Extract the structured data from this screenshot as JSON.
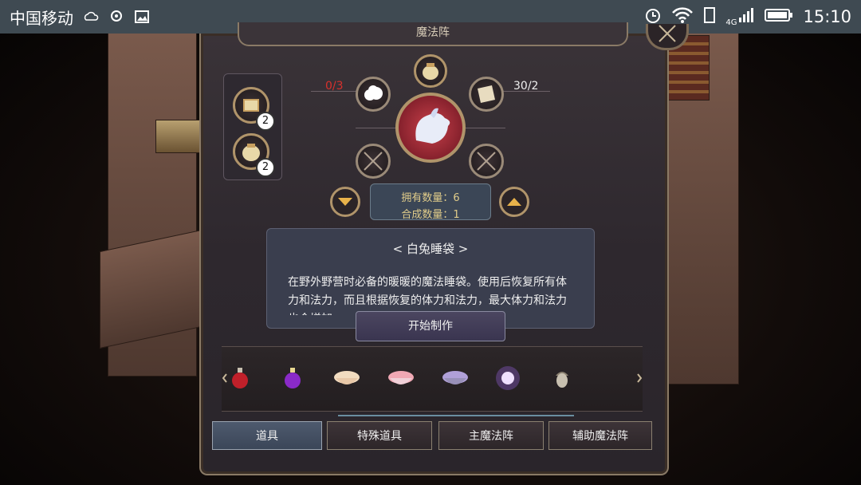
{
  "status_bar": {
    "carrier": "中国移动",
    "network": "4G",
    "time": "15:10"
  },
  "panel": {
    "title": "魔法阵"
  },
  "crafting": {
    "left_count": "0/3",
    "right_count": "30/2",
    "side_slots": [
      {
        "icon": "book-bundle-icon",
        "count": "2"
      },
      {
        "icon": "pouch-icon",
        "count": "2"
      }
    ],
    "owned_label": "拥有数量：6",
    "craft_label": "合成数量：1"
  },
  "item": {
    "name": "< 白兔睡袋 >",
    "description": "在野外野营时必备的暖暖的魔法睡袋。使用后恢复所有体力和法力，而且根据恢复的体力和法力，最大体力和法力也会增加。"
  },
  "make_button": "开始制作",
  "tabs": [
    {
      "label": "道具",
      "active": true
    },
    {
      "label": "特殊道具",
      "active": false
    },
    {
      "label": "主魔法阵",
      "active": false
    },
    {
      "label": "辅助魔法阵",
      "active": false
    }
  ],
  "item_strip": [
    {
      "icon": "red-potion-icon",
      "color": "#c0202a"
    },
    {
      "icon": "purple-potion-icon",
      "color": "#8a2ac8"
    },
    {
      "icon": "cream-bowl-icon",
      "color": "#f2dcc0"
    },
    {
      "icon": "pink-bowl-icon",
      "color": "#f0a8b4"
    },
    {
      "icon": "purple-bowl-icon",
      "color": "#b0a0d8"
    },
    {
      "icon": "glowing-orb-icon",
      "color": "#d8b8ff"
    },
    {
      "icon": "acorn-icon",
      "color": "#c8c0b0"
    }
  ],
  "colors": {
    "accent_gold": "#b0946a",
    "red_count": "#d8302c",
    "active_tab": "#4e5a6e"
  }
}
